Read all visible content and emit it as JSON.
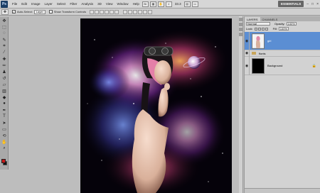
{
  "app": {
    "logo": "Ps",
    "menu": [
      "File",
      "Edit",
      "Image",
      "Layer",
      "Select",
      "Filter",
      "Analysis",
      "3D",
      "View",
      "Window",
      "Help"
    ],
    "zoom": "33.3",
    "workspace": "ESSENTIALS"
  },
  "options": {
    "auto_select_label": "Auto-Select:",
    "auto_select_value": "Layer",
    "transform_label": "Show Transform Controls"
  },
  "layers_panel": {
    "tabs": [
      "LAYERS",
      "CHANNELS"
    ],
    "blend_mode": "Normal",
    "opacity_label": "Opacity:",
    "opacity_value": "100%",
    "lock_label": "Lock:",
    "fill_label": "Fill:",
    "fill_value": "100%",
    "layers": [
      {
        "name": "girl",
        "selected": true
      },
      {
        "name": "flonts",
        "type": "group"
      },
      {
        "name": "Background",
        "locked": true
      }
    ]
  },
  "colors": {
    "selection": "#5b8ed3",
    "foreground": "#c81919",
    "background": "#111111"
  }
}
